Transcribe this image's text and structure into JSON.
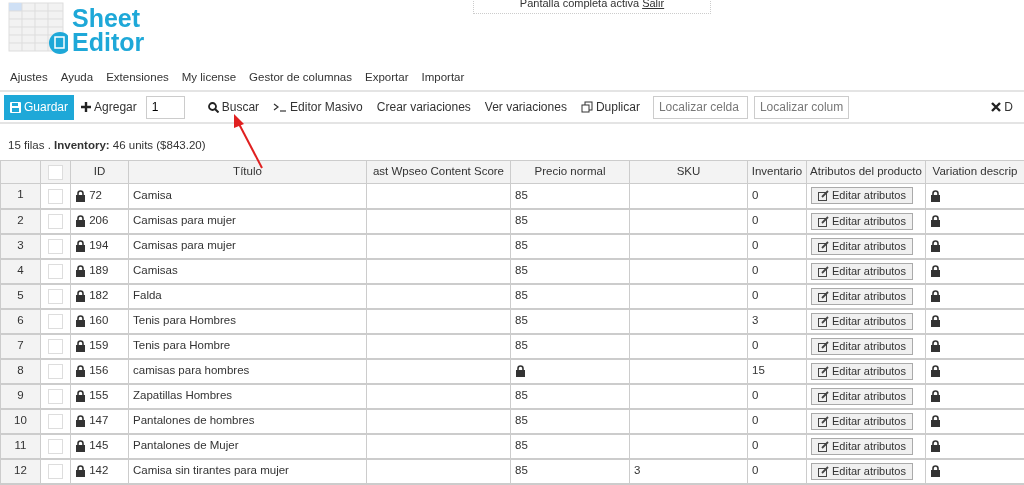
{
  "fullscreen_notice": {
    "text": "Pantalla completa activa",
    "link": "Salir"
  },
  "logo": {
    "line_1": "Sheet",
    "line_2": "Editor"
  },
  "menu": [
    "Ajustes",
    "Ayuda",
    "Extensiones",
    "My license",
    "Gestor de columnas",
    "Exportar",
    "Importar"
  ],
  "toolbar": [
    {
      "kind": "save",
      "label": "Guardar"
    },
    {
      "kind": "add",
      "label": "Agregar"
    },
    {
      "kind": "number",
      "value": "1"
    },
    {
      "kind": "search",
      "label": "Buscar"
    },
    {
      "kind": "terminal",
      "label": "Editor Masivo"
    },
    {
      "kind": "plain",
      "label": "Crear variaciones"
    },
    {
      "kind": "plain",
      "label": "Ver variaciones"
    },
    {
      "kind": "copy",
      "label": "Duplicar"
    },
    {
      "kind": "field",
      "placeholder": "Localizar celda"
    },
    {
      "kind": "field",
      "placeholder": "Localizar colum"
    },
    {
      "kind": "remove",
      "label": "D"
    }
  ],
  "summary": "15 filas . **Inventory:** 46 units ($843.20)",
  "table": {
    "select_all_checked": false,
    "columns": [
      "ID",
      "Título",
      "ast Wpseo Content Score",
      "Precio normal",
      "SKU",
      "Inventario",
      "Atributos del producto",
      "Variation descrip"
    ],
    "rows": [
      {
        "number": "1",
        "checked": false,
        "id": "72",
        "title": "Camisa",
        "price_locked": false,
        "price": "85",
        "inventory": "0",
        "attributes": "Editar atributos"
      },
      {
        "number": "2",
        "checked": false,
        "id": "206",
        "title": "Camisas para mujer",
        "price_locked": false,
        "price": "85",
        "inventory": "0",
        "attributes": "Editar atributos"
      },
      {
        "number": "3",
        "checked": false,
        "id": "194",
        "title": "Camisas para mujer",
        "price_locked": false,
        "price": "85",
        "inventory": "0",
        "attributes": "Editar atributos"
      },
      {
        "number": "4",
        "checked": false,
        "id": "189",
        "title": "Camisas",
        "price_locked": false,
        "price": "85",
        "inventory": "0",
        "attributes": "Editar atributos"
      },
      {
        "number": "5",
        "checked": false,
        "id": "182",
        "title": "Falda",
        "price_locked": false,
        "price": "85",
        "inventory": "0",
        "attributes": "Editar atributos"
      },
      {
        "number": "6",
        "checked": false,
        "id": "160",
        "title": "Tenis para Hombres",
        "price_locked": false,
        "price": "85",
        "inventory": "3",
        "attributes": "Editar atributos"
      },
      {
        "number": "7",
        "checked": false,
        "id": "159",
        "title": "Tenis para Hombre",
        "price_locked": false,
        "price": "85",
        "inventory": "0",
        "attributes": "Editar atributos"
      },
      {
        "number": "8",
        "checked": false,
        "id": "156",
        "title": "camisas para hombres",
        "price_locked": true,
        "inventory": "15",
        "attributes": "Editar atributos"
      },
      {
        "number": "9",
        "checked": false,
        "id": "155",
        "title": "Zapatillas Hombres",
        "price_locked": false,
        "price": "85",
        "inventory": "0",
        "attributes": "Editar atributos"
      },
      {
        "number": "10",
        "checked": false,
        "id": "147",
        "title": "Pantalones de hombres",
        "price_locked": false,
        "price": "85",
        "inventory": "0",
        "attributes": "Editar atributos"
      },
      {
        "number": "11",
        "checked": false,
        "id": "145",
        "title": "Pantalones de Mujer",
        "price_locked": false,
        "price": "85",
        "inventory": "0",
        "attributes": "Editar atributos"
      },
      {
        "number": "12",
        "checked": false,
        "id": "142",
        "title": "Camisa sin tirantes para mujer",
        "price_locked": false,
        "price": "85",
        "sku": "3",
        "inventory": "0",
        "attributes": "Editar atributos"
      }
    ]
  }
}
